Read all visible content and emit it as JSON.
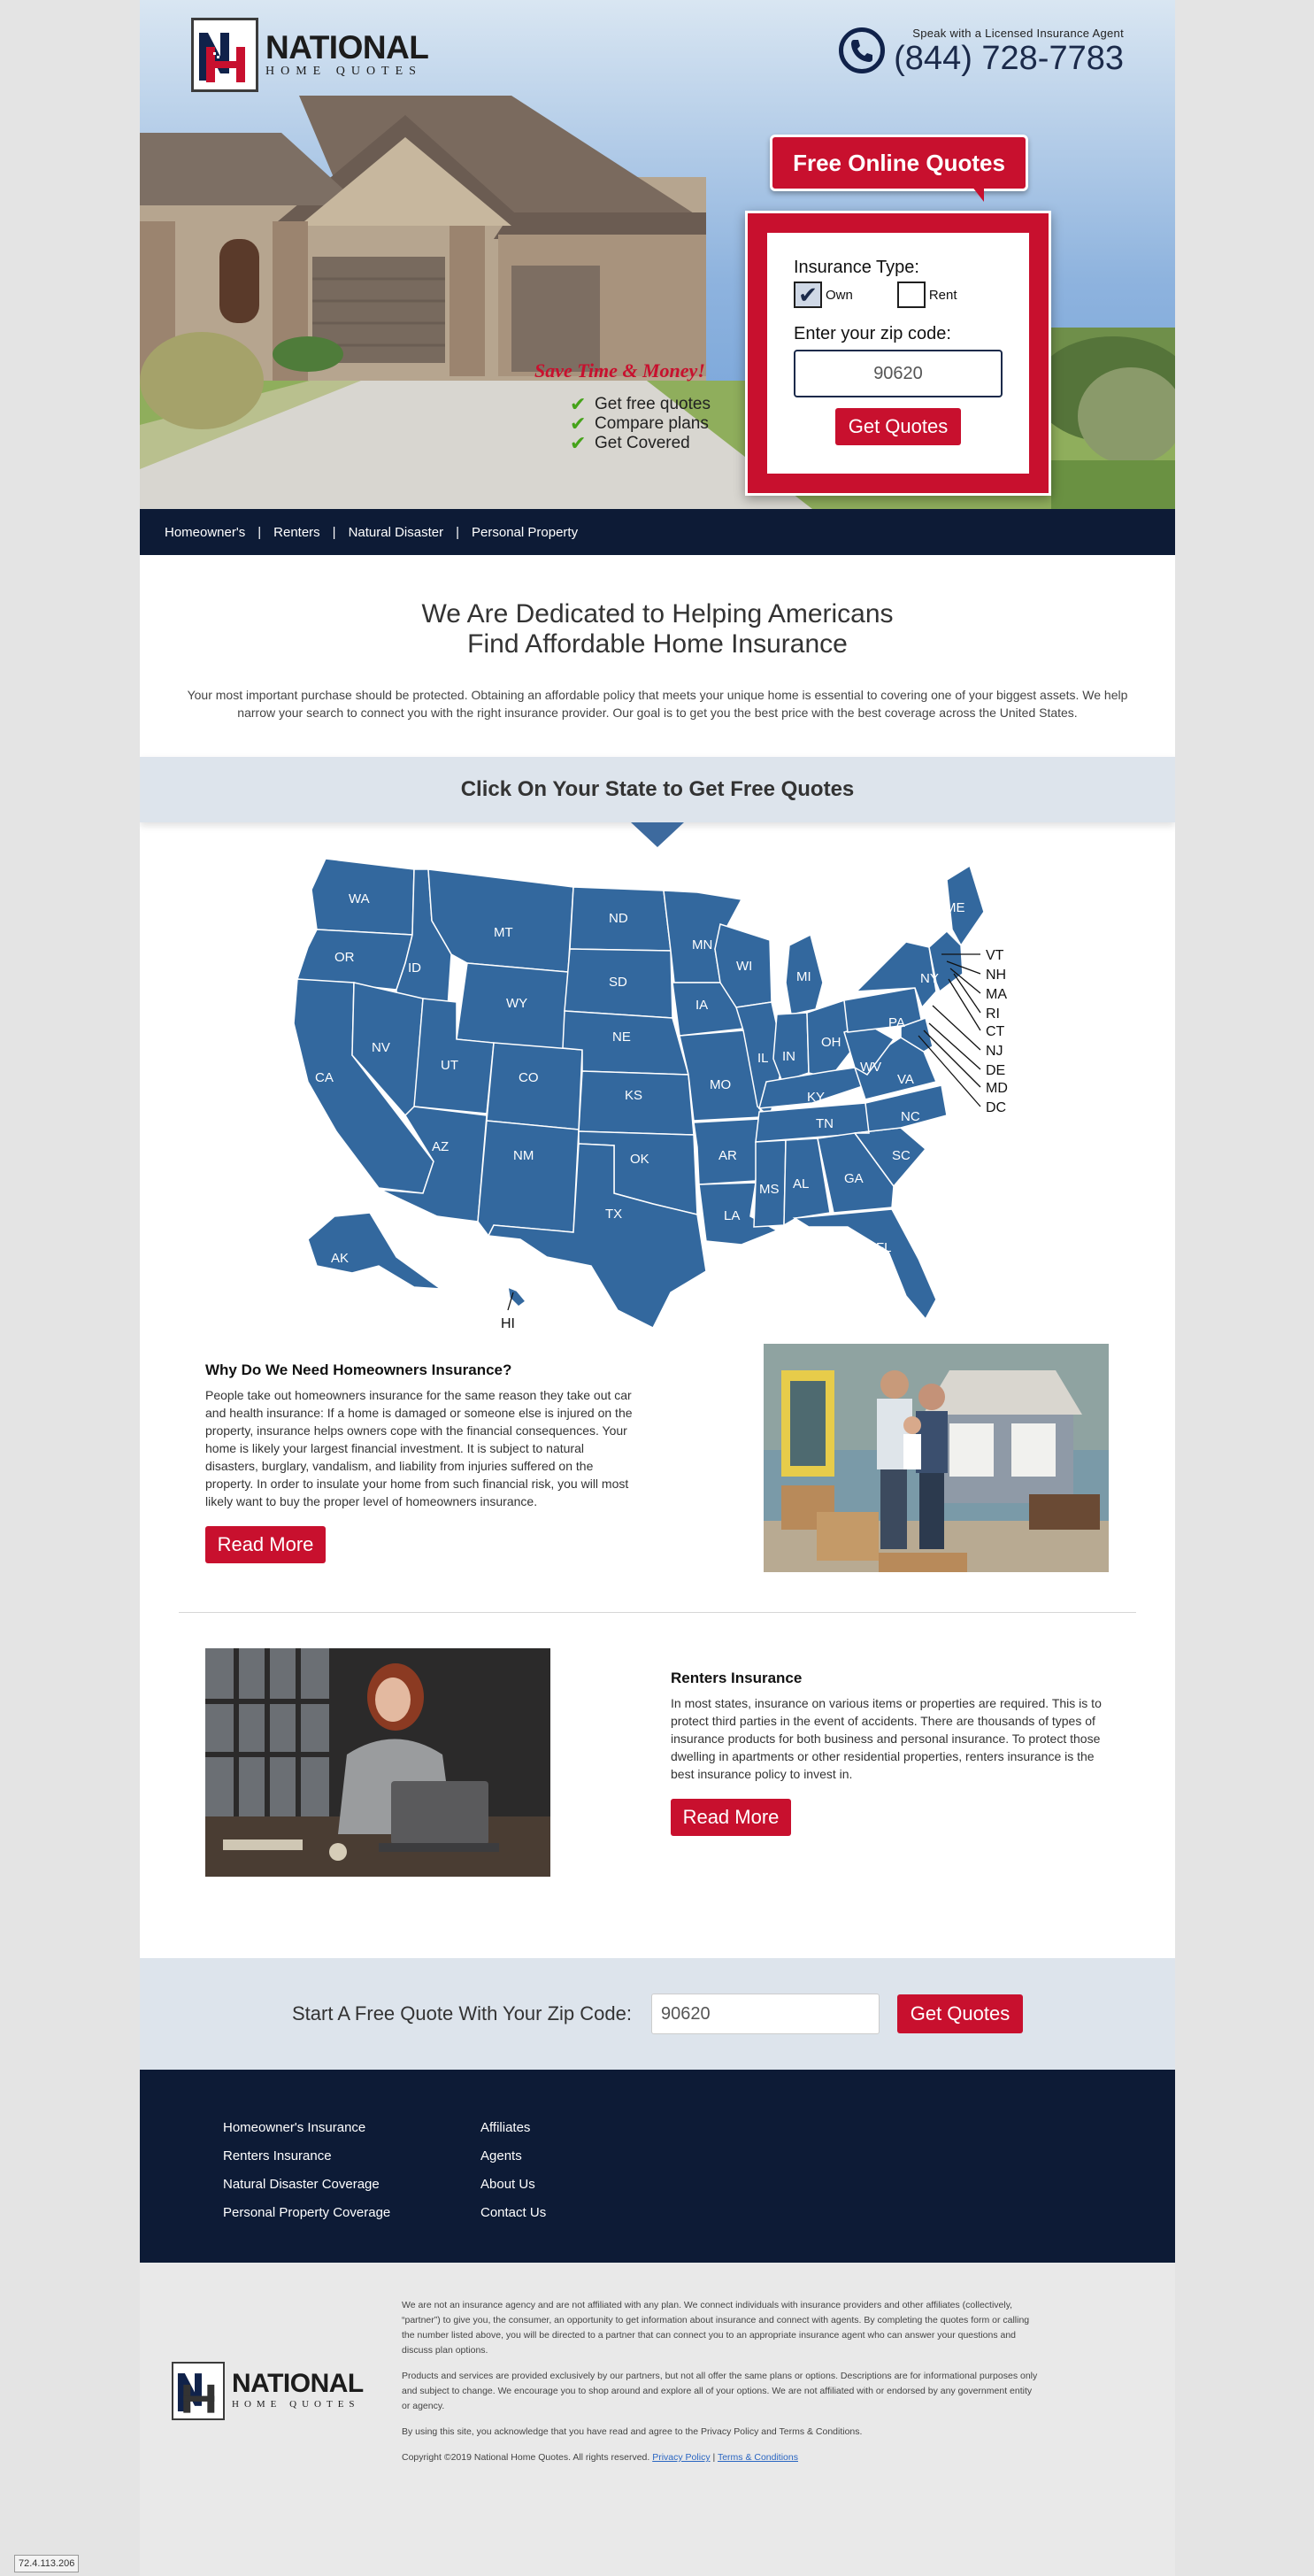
{
  "brand": {
    "logo_word": "NATIONAL",
    "logo_sub": "HOME QUOTES",
    "logo_mark": "NH"
  },
  "phone": {
    "caption": "Speak with a Licensed Insurance Agent",
    "number": "(844) 728-7783"
  },
  "hero": {
    "tagline": "Save Time & Money!",
    "checks": [
      "Get free quotes",
      "Compare plans",
      "Get Covered"
    ]
  },
  "quote_form": {
    "tab_label": "Free Online Quotes",
    "type_label": "Insurance Type:",
    "options": [
      {
        "label": "Own",
        "checked": true
      },
      {
        "label": "Rent",
        "checked": false
      }
    ],
    "zip_label": "Enter your zip code:",
    "zip_value": "90620",
    "button": "Get Quotes"
  },
  "nav": {
    "items": [
      "Homeowner's",
      "Renters",
      "Natural Disaster",
      "Personal Property"
    ]
  },
  "intro": {
    "title_line1": "We Are Dedicated to Helping Americans",
    "title_line2": "Find Affordable Home Insurance",
    "text": "Your most important purchase should be protected. Obtaining an affordable policy that meets your unique home is essential to covering one of your biggest assets. We help narrow your search to connect you with the right insurance provider. Our goal is to get you the best price with the best coverage across the United States."
  },
  "state_banner": "Click On Your State to Get Free Quotes",
  "map": {
    "states": [
      "WA",
      "OR",
      "CA",
      "ID",
      "NV",
      "MT",
      "WY",
      "UT",
      "AZ",
      "CO",
      "NM",
      "ND",
      "SD",
      "NE",
      "KS",
      "OK",
      "TX",
      "MN",
      "IA",
      "MO",
      "AR",
      "LA",
      "WI",
      "IL",
      "MI",
      "IN",
      "OH",
      "KY",
      "TN",
      "MS",
      "AL",
      "GA",
      "FL",
      "SC",
      "NC",
      "VA",
      "WV",
      "PA",
      "NY",
      "ME",
      "AK",
      "HI"
    ],
    "callouts": [
      "VT",
      "NH",
      "MA",
      "RI",
      "CT",
      "NJ",
      "DE",
      "MD",
      "DC"
    ],
    "fill_color": "#33689e"
  },
  "section1": {
    "title": "Why Do We Need Homeowners Insurance?",
    "text": "People take out homeowners insurance for the same reason they take out car and health insurance: If a home is damaged or someone else is injured on the property, insurance helps owners cope with the financial consequences. Your home is likely your largest financial investment. It is subject to natural disasters, burglary, vandalism, and liability from injuries suffered on the property. In order to insulate your home from such financial risk, you will most likely want to buy the proper level of homeowners insurance.",
    "button": "Read More"
  },
  "section2": {
    "title": "Renters Insurance",
    "text": "In most states, insurance on various items or properties are required. This is to protect third parties in the event of accidents. There are thousands of types of insurance products for both business and personal insurance. To protect those dwelling in apartments or other residential properties, renters insurance is the best insurance policy to invest in.",
    "button": "Read More"
  },
  "zipbar": {
    "label": "Start A Free Quote With Your Zip Code:",
    "zip_value": "90620",
    "button": "Get Quotes"
  },
  "footer": {
    "col1": [
      "Homeowner's Insurance",
      "Renters Insurance",
      "Natural Disaster Coverage",
      "Personal Property Coverage"
    ],
    "col2": [
      "Affiliates",
      "Agents",
      "About Us",
      "Contact Us"
    ]
  },
  "legal": {
    "p1": "We are not an insurance agency and are not affiliated with any plan. We connect individuals with insurance providers and other affiliates (collectively, “partner”) to give you, the consumer, an opportunity to get information about insurance and connect with agents. By completing the quotes form or calling the number listed above, you will be directed to a partner that can connect you to an appropriate insurance agent who can answer your questions and discuss plan options.",
    "p2": "Products and services are provided exclusively by our partners, but not all offer the same plans or options. Descriptions are for informational purposes only and subject to change. We encourage you to shop around and explore all of your options. We are not affiliated with or endorsed by any government entity or agency.",
    "p3": "By using this site, you acknowledge that you have read and agree to the Privacy Policy and Terms & Conditions.",
    "copyright": "Copyright ©2019 National Home Quotes. All rights reserved.",
    "privacy_link": "Privacy Policy",
    "terms_link": "Terms & Conditions"
  },
  "ip_badge": "72.4.113.206",
  "colors": {
    "brand_red": "#c8102e",
    "navy": "#0d1b36",
    "map_blue": "#33689e",
    "banner_gray": "#dde4ec"
  }
}
